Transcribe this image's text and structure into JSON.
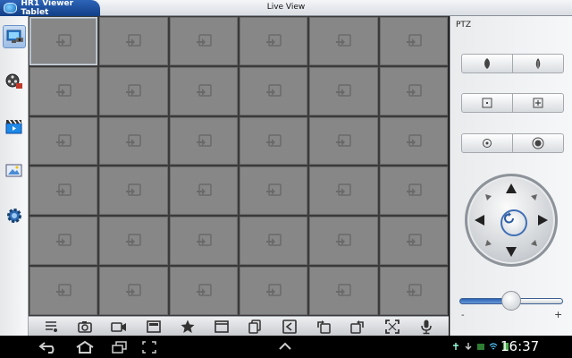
{
  "app": {
    "title": "HR1 Viewer Tablet"
  },
  "view": {
    "title": "Live View"
  },
  "sidebar": {
    "items": [
      {
        "name": "live-view",
        "icon": "monitor-camera-icon",
        "active": true
      },
      {
        "name": "playback",
        "icon": "film-reel-icon",
        "active": false
      },
      {
        "name": "video-clips",
        "icon": "clapperboard-icon",
        "active": false
      },
      {
        "name": "snapshots",
        "icon": "picture-icon",
        "active": false
      },
      {
        "name": "settings",
        "icon": "gear-icon",
        "active": false
      }
    ]
  },
  "grid": {
    "rows": 6,
    "cols": 6,
    "selected_cell": 0,
    "empty_icon": "no-video-icon"
  },
  "toolbar": {
    "tools": [
      "layout-list-icon",
      "snapshot-camera-icon",
      "record-video-icon",
      "full-frame-icon",
      "favorite-star-icon",
      "window-icon",
      "channel-group-icon",
      "prev-page-icon",
      "rotate-left-icon",
      "rotate-right-icon",
      "fullscreen-icon",
      "microphone-icon"
    ]
  },
  "ptz": {
    "title": "PTZ",
    "buttons": [
      [
        "focus-near-icon",
        "focus-far-icon"
      ],
      [
        "zoom-in-icon",
        "zoom-out-icon"
      ],
      [
        "iris-close-icon",
        "iris-open-icon"
      ]
    ],
    "center_icon": "auto-rotate-icon",
    "speed": {
      "value": 0.5,
      "minus": "-",
      "plus": "+"
    }
  },
  "system": {
    "time": "16:37"
  },
  "colors": {
    "accent": "#2d64b8",
    "cell": "#878787",
    "grid_bg": "#3a3a3a"
  }
}
